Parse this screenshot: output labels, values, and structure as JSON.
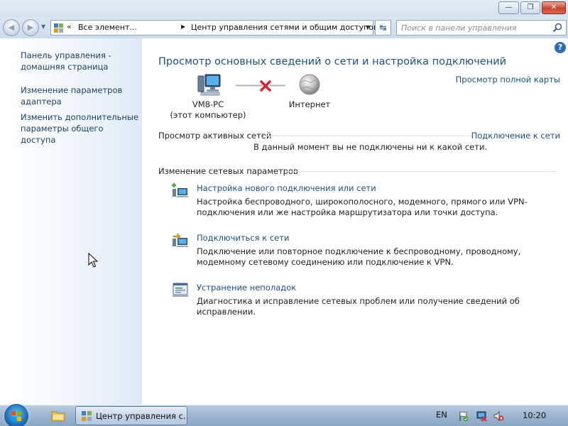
{
  "window": {
    "minimize_glyph": "—",
    "maximize_glyph": "❐",
    "close_glyph": "✕"
  },
  "nav": {
    "back_glyph": "◀",
    "forward_glyph": "▶",
    "history_glyph": "▼",
    "address_chevron": "«",
    "address_parts": [
      "Все элемент...",
      "Центр управления сетями и общим доступом"
    ],
    "address_separator": "▶",
    "address_dropdown_glyph": "▼",
    "refresh_glyph": "↹",
    "search_placeholder": "Поиск в панели управления"
  },
  "sidebar": {
    "items": [
      {
        "label": "Панель управления - домашняя страница"
      },
      {
        "label": "Изменение параметров адаптера"
      },
      {
        "label": "Изменить дополнительные параметры общего доступа"
      }
    ]
  },
  "main": {
    "help_glyph": "?",
    "title": "Просмотр основных сведений о сети и настройка подключений",
    "full_map_link": "Просмотр полной карты",
    "network_map": {
      "computer_name": "VM8-PC",
      "computer_note": "(этот компьютер)",
      "internet_label": "Интернет",
      "status_icon": "disconnected-x-icon"
    },
    "active_networks": {
      "heading": "Просмотр активных сетей",
      "connect_link": "Подключение к сети",
      "message": "В данный момент вы не подключены ни к какой сети."
    },
    "change_settings": {
      "heading": "Изменение сетевых параметров",
      "tasks": [
        {
          "icon": "new-connection-icon",
          "title": "Настройка нового подключения или сети",
          "description": "Настройка беспроводного, широкополосного, модемного, прямого или VPN-подключения или же настройка маршрутизатора или точки доступа."
        },
        {
          "icon": "connect-network-icon",
          "title": "Подключиться к сети",
          "description": "Подключение или повторное подключение к беспроводному, проводному, модемному сетевому соединению или подключение к VPN."
        },
        {
          "icon": "troubleshoot-icon",
          "title": "Устранение неполадок",
          "description": "Диагностика и исправление сетевых проблем или получение сведений об исправлении."
        }
      ]
    }
  },
  "taskbar": {
    "active_window_label": "Центр управления с...",
    "language": "EN",
    "clock": "10:20"
  },
  "colors": {
    "link": "#1e4d85",
    "title": "#1f4f80",
    "error_x": "#d8262c"
  }
}
